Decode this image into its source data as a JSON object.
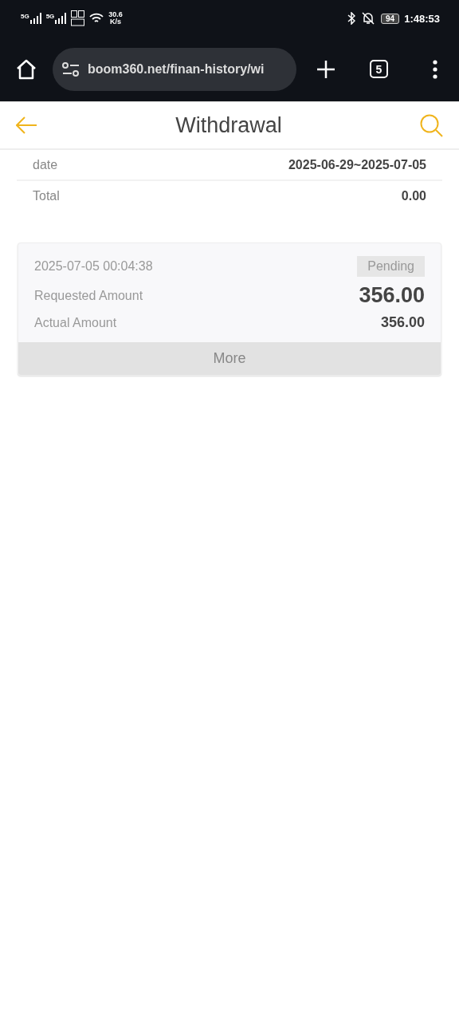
{
  "status_bar": {
    "signal_labels": [
      "5G",
      "5G"
    ],
    "speed": "30.6",
    "speed_unit": "K/s",
    "battery": "94",
    "time": "1:48:53"
  },
  "browser": {
    "url": "boom360.net/finan-history/wi",
    "tab_count": "5"
  },
  "header": {
    "title": "Withdrawal"
  },
  "summary": [
    {
      "label": "date",
      "value": "2025-06-29~2025-07-05"
    },
    {
      "label": "Total",
      "value": "0.00"
    }
  ],
  "records": [
    {
      "time": "2025-07-05 00:04:38",
      "status": "Pending",
      "requested_label": "Requested Amount",
      "requested_amount": "356.00",
      "actual_label": "Actual Amount",
      "actual_amount": "356.00",
      "more": "More"
    }
  ]
}
